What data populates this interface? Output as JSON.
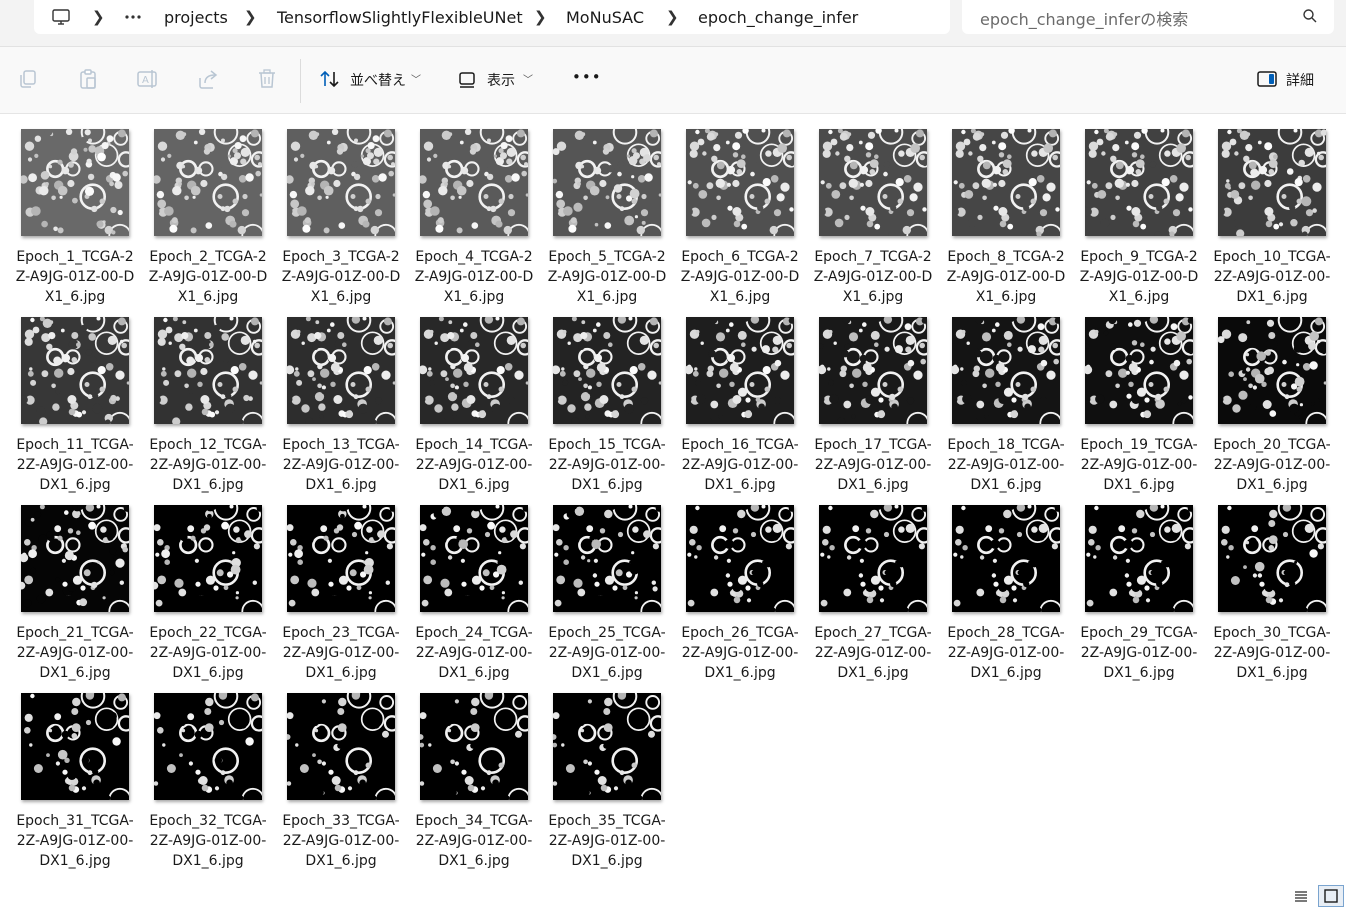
{
  "address": {
    "crumbs": [
      "projects",
      "TensorflowSlightlyFlexibleUNet",
      "MoNuSAC",
      "epoch_change_infer"
    ]
  },
  "search": {
    "placeholder": "epoch_change_inferの検索"
  },
  "toolbar": {
    "sort_label": "並べ替え",
    "view_label": "表示",
    "more_label": "•••",
    "details_label": "詳細"
  },
  "files": [
    "Epoch_1_TCGA-2Z-A9JG-01Z-00-DX1_6.jpg",
    "Epoch_2_TCGA-2Z-A9JG-01Z-00-DX1_6.jpg",
    "Epoch_3_TCGA-2Z-A9JG-01Z-00-DX1_6.jpg",
    "Epoch_4_TCGA-2Z-A9JG-01Z-00-DX1_6.jpg",
    "Epoch_5_TCGA-2Z-A9JG-01Z-00-DX1_6.jpg",
    "Epoch_6_TCGA-2Z-A9JG-01Z-00-DX1_6.jpg",
    "Epoch_7_TCGA-2Z-A9JG-01Z-00-DX1_6.jpg",
    "Epoch_8_TCGA-2Z-A9JG-01Z-00-DX1_6.jpg",
    "Epoch_9_TCGA-2Z-A9JG-01Z-00-DX1_6.jpg",
    "Epoch_10_TCGA-2Z-A9JG-01Z-00-DX1_6.jpg",
    "Epoch_11_TCGA-2Z-A9JG-01Z-00-DX1_6.jpg",
    "Epoch_12_TCGA-2Z-A9JG-01Z-00-DX1_6.jpg",
    "Epoch_13_TCGA-2Z-A9JG-01Z-00-DX1_6.jpg",
    "Epoch_14_TCGA-2Z-A9JG-01Z-00-DX1_6.jpg",
    "Epoch_15_TCGA-2Z-A9JG-01Z-00-DX1_6.jpg",
    "Epoch_16_TCGA-2Z-A9JG-01Z-00-DX1_6.jpg",
    "Epoch_17_TCGA-2Z-A9JG-01Z-00-DX1_6.jpg",
    "Epoch_18_TCGA-2Z-A9JG-01Z-00-DX1_6.jpg",
    "Epoch_19_TCGA-2Z-A9JG-01Z-00-DX1_6.jpg",
    "Epoch_20_TCGA-2Z-A9JG-01Z-00-DX1_6.jpg",
    "Epoch_21_TCGA-2Z-A9JG-01Z-00-DX1_6.jpg",
    "Epoch_22_TCGA-2Z-A9JG-01Z-00-DX1_6.jpg",
    "Epoch_23_TCGA-2Z-A9JG-01Z-00-DX1_6.jpg",
    "Epoch_24_TCGA-2Z-A9JG-01Z-00-DX1_6.jpg",
    "Epoch_25_TCGA-2Z-A9JG-01Z-00-DX1_6.jpg",
    "Epoch_26_TCGA-2Z-A9JG-01Z-00-DX1_6.jpg",
    "Epoch_27_TCGA-2Z-A9JG-01Z-00-DX1_6.jpg",
    "Epoch_28_TCGA-2Z-A9JG-01Z-00-DX1_6.jpg",
    "Epoch_29_TCGA-2Z-A9JG-01Z-00-DX1_6.jpg",
    "Epoch_30_TCGA-2Z-A9JG-01Z-00-DX1_6.jpg",
    "Epoch_31_TCGA-2Z-A9JG-01Z-00-DX1_6.jpg",
    "Epoch_32_TCGA-2Z-A9JG-01Z-00-DX1_6.jpg",
    "Epoch_33_TCGA-2Z-A9JG-01Z-00-DX1_6.jpg",
    "Epoch_34_TCGA-2Z-A9JG-01Z-00-DX1_6.jpg",
    "Epoch_35_TCGA-2Z-A9JG-01Z-00-DX1_6.jpg"
  ],
  "colors": {
    "address_bg": "#f3f3f3",
    "toolbar_bg": "#f9f9f9",
    "accent": "#005fb8",
    "disabled_icon": "#b9c6d3"
  },
  "icons": [
    "this-pc-icon",
    "chevron-right-icon",
    "more-icon",
    "search-icon",
    "copy-icon",
    "paste-icon",
    "rename-icon",
    "share-icon",
    "delete-icon",
    "sort-icon",
    "view-icon",
    "details-pane-icon",
    "details-view-icon",
    "large-icons-view-icon"
  ]
}
